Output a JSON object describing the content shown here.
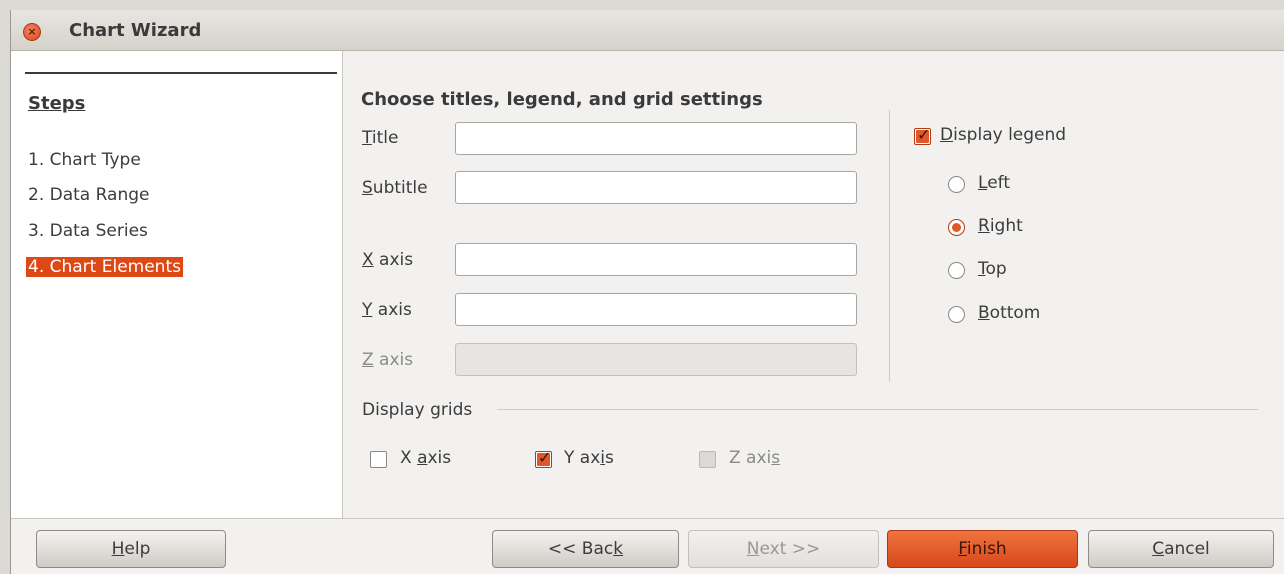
{
  "window": {
    "title": "Chart Wizard"
  },
  "steps": {
    "heading": "Steps",
    "items": [
      {
        "label": "1. Chart Type",
        "active": false
      },
      {
        "label": "2. Data Range",
        "active": false
      },
      {
        "label": "3. Data Series",
        "active": false
      },
      {
        "label": "4. Chart Elements",
        "active": true
      }
    ]
  },
  "content": {
    "title": "Choose titles, legend, and grid settings",
    "fields": {
      "title": {
        "label_ul": "T",
        "label_rest": "itle",
        "value": ""
      },
      "subtitle": {
        "label_ul": "S",
        "label_rest": "ubtitle",
        "value": ""
      },
      "x_axis": {
        "label_ul": "X",
        "label_rest": " axis",
        "value": ""
      },
      "y_axis": {
        "label_ul": "Y",
        "label_rest": " axis",
        "value": ""
      },
      "z_axis": {
        "label_ul": "Z",
        "label_rest": " axis",
        "value": "",
        "disabled": true
      }
    },
    "legend": {
      "display_ul": "D",
      "display_rest": "isplay legend",
      "display_checked": true,
      "options": [
        {
          "ul": "L",
          "rest": "eft",
          "checked": false
        },
        {
          "ul": "R",
          "rest": "ight",
          "checked": true
        },
        {
          "ul": "T",
          "rest": "op",
          "checked": false
        },
        {
          "ul": "B",
          "rest": "ottom",
          "checked": false
        }
      ]
    },
    "grids": {
      "label": "Display grids",
      "x": {
        "pre": "X ",
        "ul": "a",
        "post": "xis",
        "checked": false
      },
      "y": {
        "pre": "Y ax",
        "ul": "i",
        "post": "s",
        "checked": true
      },
      "z": {
        "pre": "Z axi",
        "ul": "s",
        "post": "",
        "checked": false,
        "disabled": true
      }
    }
  },
  "buttons": {
    "help": {
      "ul": "H",
      "rest": "elp"
    },
    "back": {
      "pre": "<< Bac",
      "ul": "k",
      "post": ""
    },
    "next": {
      "ul": "N",
      "rest": "ext >>"
    },
    "finish": {
      "ul": "F",
      "rest": "inish"
    },
    "cancel": {
      "ul": "C",
      "rest": "ancel"
    }
  }
}
